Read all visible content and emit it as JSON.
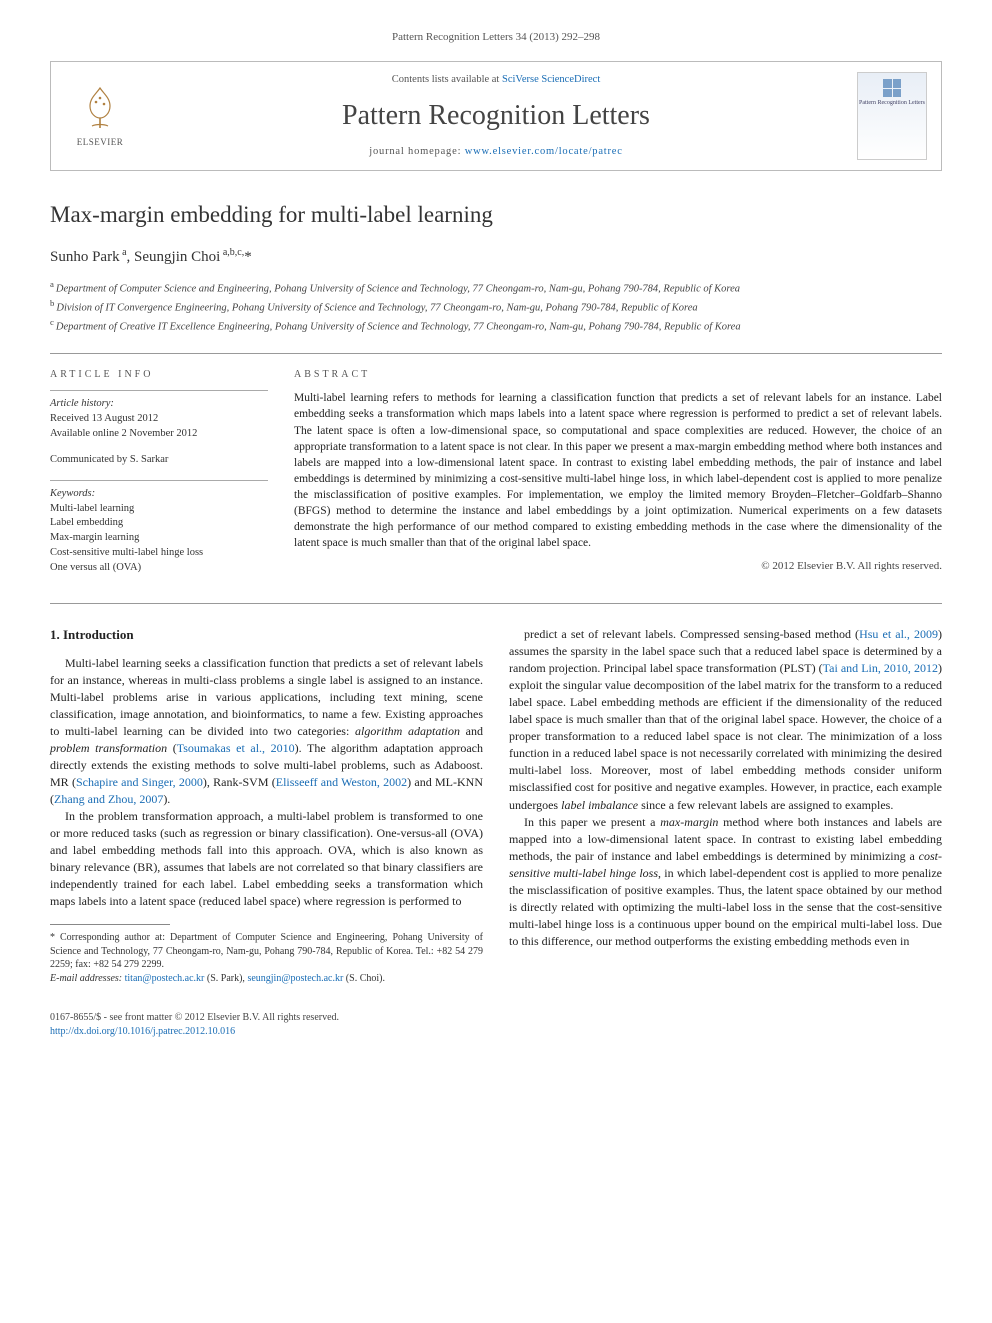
{
  "header_ref": "Pattern Recognition Letters 34 (2013) 292–298",
  "banner": {
    "publisher": "ELSEVIER",
    "contents_prefix": "Contents lists available at ",
    "contents_link": "SciVerse ScienceDirect",
    "journal": "Pattern Recognition Letters",
    "homepage_prefix": "journal homepage: ",
    "homepage_url": "www.elsevier.com/locate/patrec",
    "cover_caption": "Pattern Recognition Letters"
  },
  "title": "Max-margin embedding for multi-label learning",
  "authors_html": "Sunho Park <sup>a</sup>, Seungjin Choi <sup>a,b,c,</sup>",
  "corr_marker": "*",
  "affiliations": [
    {
      "sup": "a",
      "text": "Department of Computer Science and Engineering, Pohang University of Science and Technology, 77 Cheongam-ro, Nam-gu, Pohang 790-784, Republic of Korea"
    },
    {
      "sup": "b",
      "text": "Division of IT Convergence Engineering, Pohang University of Science and Technology, 77 Cheongam-ro, Nam-gu, Pohang 790-784, Republic of Korea"
    },
    {
      "sup": "c",
      "text": "Department of Creative IT Excellence Engineering, Pohang University of Science and Technology, 77 Cheongam-ro, Nam-gu, Pohang 790-784, Republic of Korea"
    }
  ],
  "article_info": {
    "heading": "ARTICLE INFO",
    "history_label": "Article history:",
    "received": "Received 13 August 2012",
    "online": "Available online 2 November 2012",
    "communicated": "Communicated by S. Sarkar",
    "keywords_label": "Keywords:",
    "keywords": [
      "Multi-label learning",
      "Label embedding",
      "Max-margin learning",
      "Cost-sensitive multi-label hinge loss",
      "One versus all (OVA)"
    ]
  },
  "abstract": {
    "heading": "ABSTRACT",
    "text": "Multi-label learning refers to methods for learning a classification function that predicts a set of relevant labels for an instance. Label embedding seeks a transformation which maps labels into a latent space where regression is performed to predict a set of relevant labels. The latent space is often a low-dimensional space, so computational and space complexities are reduced. However, the choice of an appropriate transformation to a latent space is not clear. In this paper we present a max-margin embedding method where both instances and labels are mapped into a low-dimensional latent space. In contrast to existing label embedding methods, the pair of instance and label embeddings is determined by minimizing a cost-sensitive multi-label hinge loss, in which label-dependent cost is applied to more penalize the misclassification of positive examples. For implementation, we employ the limited memory Broyden–Fletcher–Goldfarb–Shanno (BFGS) method to determine the instance and label embeddings by a joint optimization. Numerical experiments on a few datasets demonstrate the high performance of our method compared to existing embedding methods in the case where the dimensionality of the latent space is much smaller than that of the original label space.",
    "copyright": "© 2012 Elsevier B.V. All rights reserved."
  },
  "section1": {
    "heading": "1. Introduction",
    "p1a": "Multi-label learning seeks a classification function that predicts a set of relevant labels for an instance, whereas in multi-class problems a single label is assigned to an instance. Multi-label problems arise in various applications, including text mining, scene classification, image annotation, and bioinformatics, to name a few. Existing approaches to multi-label learning can be divided into two categories: ",
    "p1_em1": "algorithm adaptation",
    "p1_mid1": " and ",
    "p1_em2": "problem transformation",
    "p1b": " (",
    "p1_ref1": "Tsoumakas et al., 2010",
    "p1c": "). The algorithm adaptation approach directly extends the existing methods to solve multi-label problems, such as Adaboost. MR (",
    "p1_ref2": "Schapire and Singer, 2000",
    "p1d": "), Rank-SVM (",
    "p1_ref3": "Elisseeff and Weston, 2002",
    "p1e": ") and ML-KNN (",
    "p1_ref4": "Zhang and Zhou, 2007",
    "p1f": ").",
    "p2": "In the problem transformation approach, a multi-label problem is transformed to one or more reduced tasks (such as regression or binary classification). One-versus-all (OVA) and label embedding methods fall into this approach. OVA, which is also known as binary relevance (BR), assumes that labels are not correlated so that binary classifiers are independently trained for each label. Label embedding seeks a transformation which maps labels into a latent space (reduced label space) where regression is performed to ",
    "p3a": "predict a set of relevant labels. Compressed sensing-based method (",
    "p3_ref1": "Hsu et al., 2009",
    "p3b": ") assumes the sparsity in the label space such that a reduced label space is determined by a random projection. Principal label space transformation (PLST) (",
    "p3_ref2": "Tai and Lin, 2010, 2012",
    "p3c": ") exploit the singular value decomposition of the label matrix for the transform to a reduced label space. Label embedding methods are efficient if the dimensionality of the reduced label space is much smaller than that of the original label space. However, the choice of a proper transformation to a reduced label space is not clear. The minimization of a loss function in a reduced label space is not necessarily correlated with minimizing the desired multi-label loss. Moreover, most of label embedding methods consider uniform misclassified cost for positive and negative examples. However, in practice, each example undergoes ",
    "p3_em1": "label imbalance",
    "p3d": " since a few relevant labels are assigned to examples.",
    "p4a": "In this paper we present a ",
    "p4_em1": "max-margin",
    "p4b": " method where both instances and labels are mapped into a low-dimensional latent space. In contrast to existing label embedding methods, the pair of instance and label embeddings is determined by minimizing a ",
    "p4_em2": "cost-sensitive multi-label hinge loss",
    "p4c": ", in which label-dependent cost is applied to more penalize the misclassification of positive examples. Thus, the latent space obtained by our method is directly related with optimizing the multi-label loss in the sense that the cost-sensitive multi-label hinge loss is a continuous upper bound on the empirical multi-label loss. Due to this difference, our method outperforms the existing embedding methods even in"
  },
  "footnote": {
    "corr": "* Corresponding author at: Department of Computer Science and Engineering, Pohang University of Science and Technology, 77 Cheongam-ro, Nam-gu, Pohang 790-784, Republic of Korea. Tel.: +82 54 279 2259; fax: +82 54 279 2299.",
    "email_label": "E-mail addresses: ",
    "email1": "titan@postech.ac.kr",
    "email1_who": " (S. Park), ",
    "email2": "seungjin@postech.ac.kr",
    "email2_who": " (S. Choi)."
  },
  "footer": {
    "left1": "0167-8655/$ - see front matter © 2012 Elsevier B.V. All rights reserved.",
    "left2": "http://dx.doi.org/10.1016/j.patrec.2012.10.016"
  }
}
